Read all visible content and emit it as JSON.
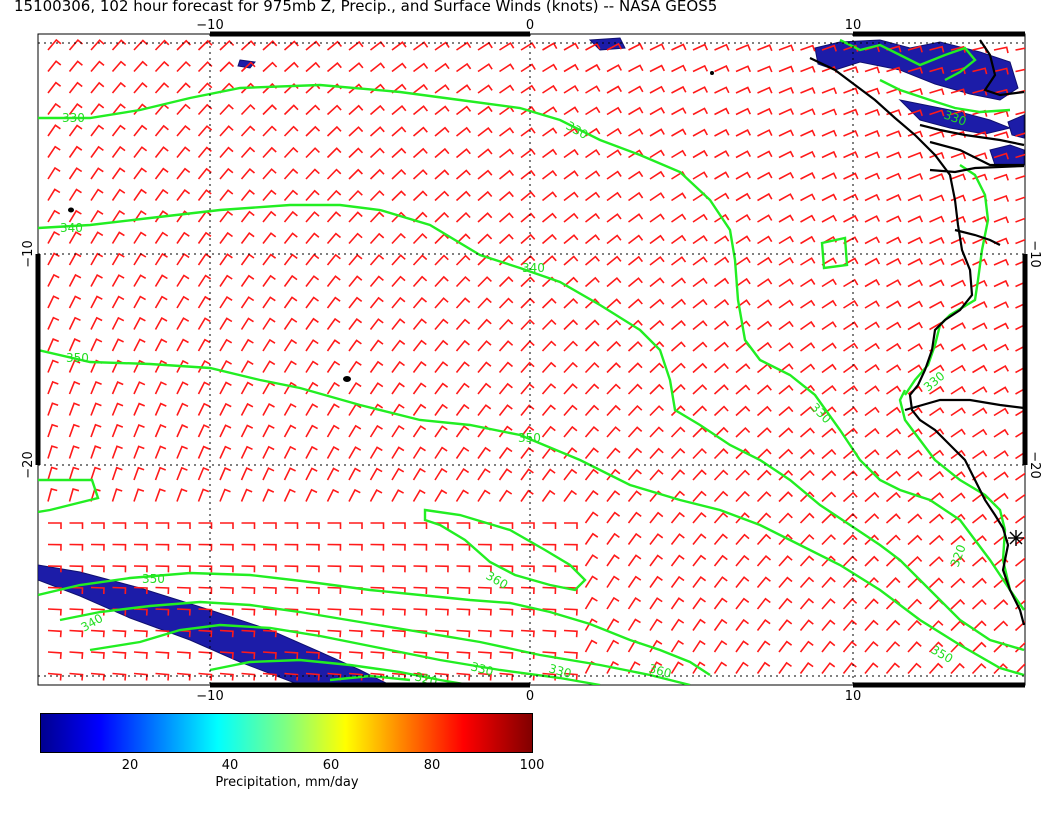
{
  "title": "15100306, 102 hour forecast for 975mb Z, Precip., and Surface Winds (knots) -- NASA GEOS5",
  "map": {
    "lon_ticks_top": [
      "−10",
      "0",
      "10"
    ],
    "lon_ticks_bottom": [
      "−10",
      "0",
      "10"
    ],
    "lat_ticks_left": [
      "−10",
      "−20"
    ],
    "lat_ticks_right": [
      "−10",
      "−20"
    ],
    "contour_labels": [
      "330",
      "330",
      "340",
      "340",
      "350",
      "350",
      "360",
      "350",
      "340",
      "330",
      "320",
      "350",
      "330",
      "330",
      "320",
      "360",
      "330",
      "330"
    ],
    "colors": {
      "contour": "#22ee22",
      "wind_barb": "#ff0000",
      "precip": "#1a1aa6",
      "coast": "#000000"
    }
  },
  "colorbar": {
    "label": "Precipitation, mm/day",
    "ticks": [
      "20",
      "40",
      "60",
      "80",
      "100"
    ],
    "range": [
      0,
      100
    ],
    "colormap": "jet"
  }
}
